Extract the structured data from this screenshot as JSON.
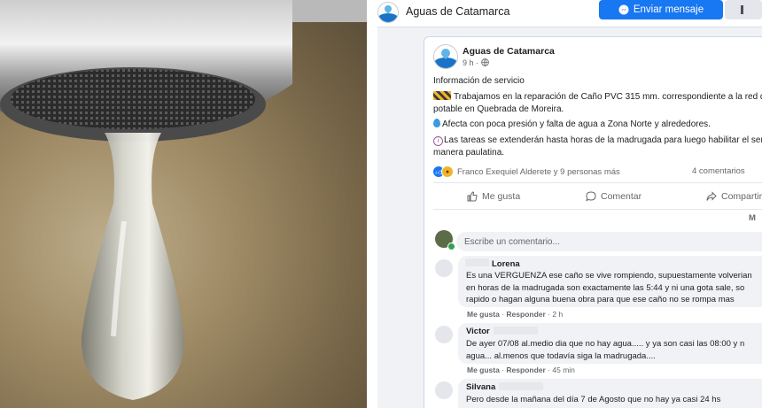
{
  "topbar": {
    "page_name": "Aguas de Catamarca",
    "message_button": "Enviar mensaje"
  },
  "post": {
    "page_name": "Aguas de Catamarca",
    "time": "9 h",
    "separator": "·",
    "lines": [
      "Información de servicio",
      "Trabajamos en la reparación de  Caño PVC 315 mm. correspondiente a la red de",
      "potable en Quebrada de Moreira.",
      "Afecta con poca presión y falta de agua a Zona Norte y alrededores.",
      "Las tareas se extenderán hasta horas de la madrugada para luego habilitar el servicio de",
      "manera paulatina."
    ],
    "reactions_text": "Franco Exequiel Alderete y 9 personas más",
    "comments_count": "4 comentarios",
    "actions": {
      "like": "Me gusta",
      "comment": "Comentar",
      "share": "Compartir"
    },
    "more_label": "M",
    "comment_placeholder": "Escribe un comentario..."
  },
  "comments": [
    {
      "name": "Lorena",
      "lines": [
        "Es una VERGUENZA ese caño se vive rompiendo, supuestamente volverian",
        "en horas de la madrugada son exactamente las 5:44 y ni una gota sale, so",
        "rapido o hagan alguna buena obra para que ese caño no se rompa mas"
      ],
      "like": "Me gusta",
      "reply": "Responder",
      "time": "2 h"
    },
    {
      "name": "Victor",
      "lines": [
        "De ayer 07/08 al.medio dia que no hay agua..... y ya son casi las 08:00 y n",
        "agua... al.menos que todavía siga la madrugada...."
      ],
      "like": "Me gusta",
      "reply": "Responder",
      "time": "45 min"
    },
    {
      "name": "Silvana",
      "lines": [
        "Pero desde la mañana del día 7 de Agosto que no hay ya casi 24 hs"
      ]
    }
  ],
  "colors": {
    "brand_blue": "#1877f2",
    "muted_text": "#65676b"
  },
  "icons": [
    "messenger-icon",
    "construction-icon",
    "water-drop-icon",
    "info-icon",
    "like-reaction-icon",
    "wow-reaction-icon",
    "thumbs-up-icon",
    "comment-icon",
    "share-icon"
  ]
}
